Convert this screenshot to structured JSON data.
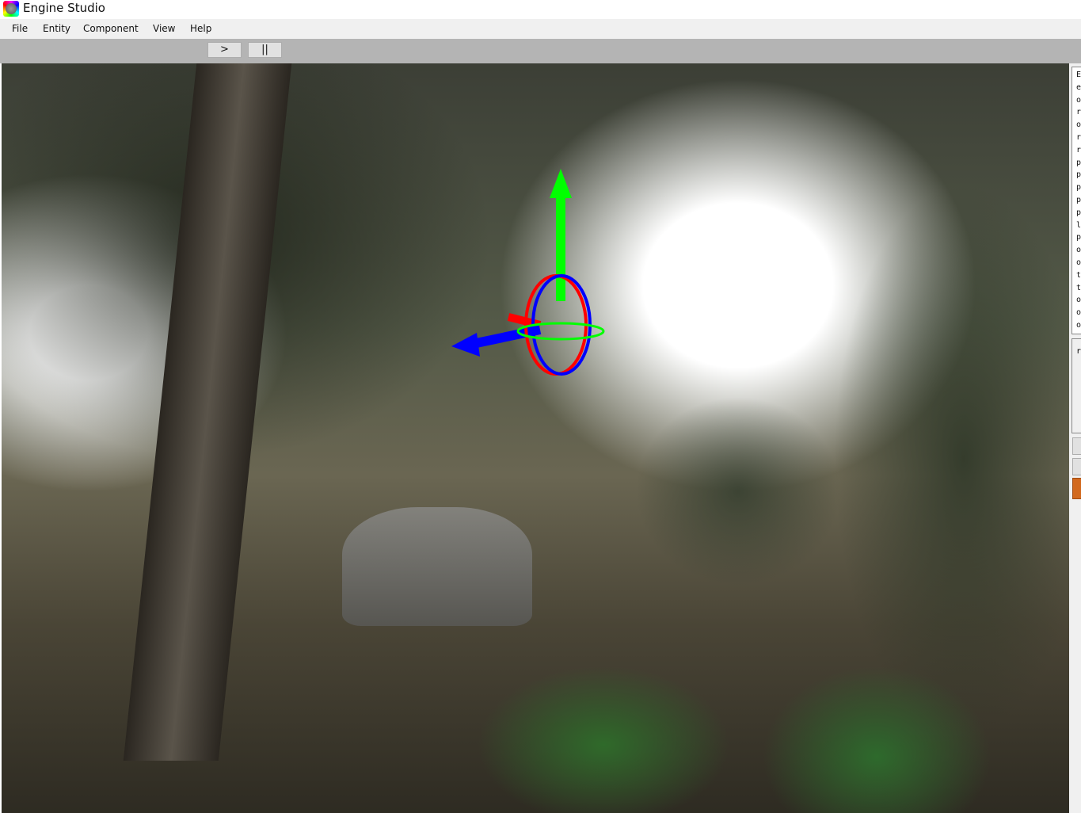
{
  "window": {
    "title": "Engine Studio"
  },
  "menu": [
    "File",
    "Entity",
    "Component",
    "View",
    "Help"
  ],
  "toolbar": {
    "play_label": ">",
    "pause_label": "||"
  },
  "side_panel": {
    "entity_list_letters": [
      "E",
      "e",
      "o",
      "r",
      "o",
      "r",
      "r",
      "p",
      "p",
      "p",
      "p",
      "p",
      "l",
      "p",
      "o",
      "o",
      "t",
      "t",
      "o",
      "o",
      "o"
    ],
    "property_letter": "r"
  },
  "colors": {
    "gizmo_x": "#ff0000",
    "gizmo_y": "#00ff00",
    "gizmo_z": "#0000ff",
    "accent_button": "#d2691e"
  }
}
